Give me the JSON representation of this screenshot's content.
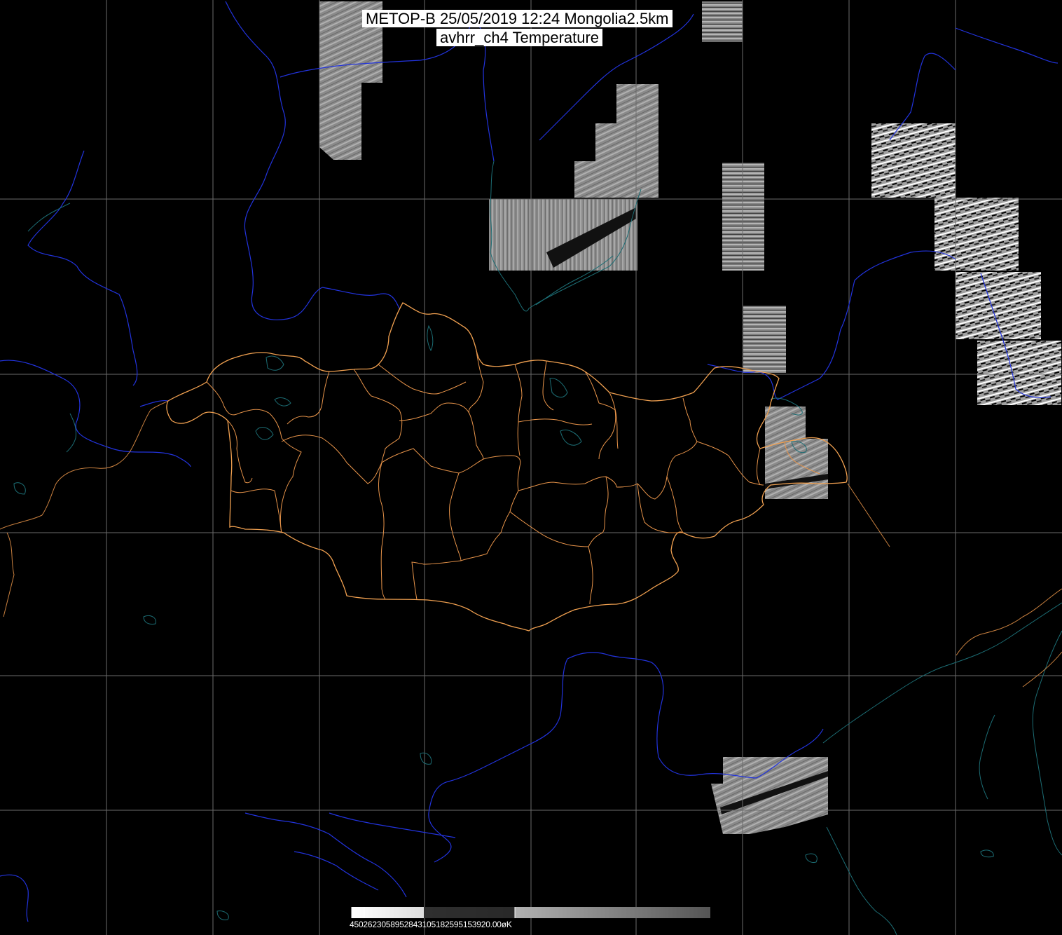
{
  "title": {
    "line1": "METOP-B 25/05/2019 12:24 Mongolia2.5km",
    "line2": "avhrr_ch4 Temperature"
  },
  "colorbar": {
    "tick_text": "4502623058952843105182595153920.00øK",
    "colors": {
      "start": "#ffffff",
      "end": "#555555"
    }
  },
  "map": {
    "colors": {
      "background": "#000000",
      "graticule": "#6b6b6b",
      "rivers": "#2233dd",
      "lakes_coast": "#1c6d74",
      "borders": "#f0a050",
      "provinces": "#e8944a",
      "foreign_borders": "#c9803f"
    }
  }
}
